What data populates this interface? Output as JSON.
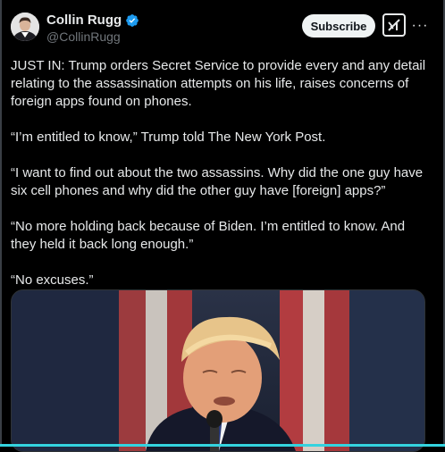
{
  "author": {
    "name": "Collin Rugg",
    "handle": "@CollinRugg",
    "verified": true
  },
  "header": {
    "subscribe_label": "Subscribe",
    "grok_icon": "grok-icon",
    "more_label": "···"
  },
  "tweet": {
    "paragraphs": [
      "JUST IN: Trump orders Secret Service to provide every and any detail relating to the assassination attempts on his life, raises concerns of foreign apps found on phones.",
      "“I’m entitled to know,” Trump told The New York Post.",
      "“I want to find out about the two assassins. Why did the one guy have six cell phones and why did the other guy have [foreign] apps?”",
      "“No more holding back because of Biden. I’m entitled to know. And they held it back long enough.”",
      "“No excuses.”"
    ]
  },
  "colors": {
    "background": "#000000",
    "text": "#e7e9ea",
    "muted": "#71767b",
    "verified": "#1d9bf0",
    "accent_bar": "#34d3df"
  }
}
